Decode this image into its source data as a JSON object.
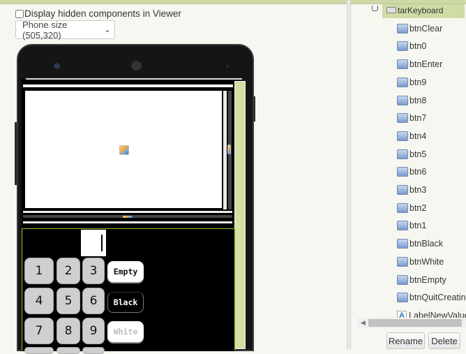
{
  "viewer": {
    "hidden_components_label": "Display hidden components in Viewer",
    "hidden_components_checked": false,
    "size_select_value": "Phone size (505,320)"
  },
  "phone_screen": {
    "textbox_value": "",
    "keypad": {
      "numbers": [
        "1",
        "2",
        "3",
        "4",
        "5",
        "6",
        "7",
        "8",
        "9"
      ],
      "side_buttons": [
        "Empty",
        "Black",
        "White"
      ]
    }
  },
  "components": {
    "parent": "tarKeyboard",
    "items": [
      {
        "name": "btnClear",
        "icon": "button-icon"
      },
      {
        "name": "btn0",
        "icon": "button-icon"
      },
      {
        "name": "btnEnter",
        "icon": "button-icon"
      },
      {
        "name": "btn9",
        "icon": "button-icon"
      },
      {
        "name": "btn8",
        "icon": "button-icon"
      },
      {
        "name": "btn7",
        "icon": "button-icon"
      },
      {
        "name": "btn4",
        "icon": "button-icon"
      },
      {
        "name": "btn5",
        "icon": "button-icon"
      },
      {
        "name": "btn6",
        "icon": "button-icon"
      },
      {
        "name": "btn3",
        "icon": "button-icon"
      },
      {
        "name": "btn2",
        "icon": "button-icon"
      },
      {
        "name": "btn1",
        "icon": "button-icon"
      },
      {
        "name": "btnBlack",
        "icon": "button-icon"
      },
      {
        "name": "btnWhite",
        "icon": "button-icon"
      },
      {
        "name": "btnEmpty",
        "icon": "button-icon"
      },
      {
        "name": "btnQuitCreating",
        "icon": "button-icon"
      },
      {
        "name": "LabelNewValue",
        "icon": "label-icon"
      }
    ],
    "label_icon_glyph": "A",
    "rename_label": "Rename",
    "delete_label": "Delete"
  }
}
